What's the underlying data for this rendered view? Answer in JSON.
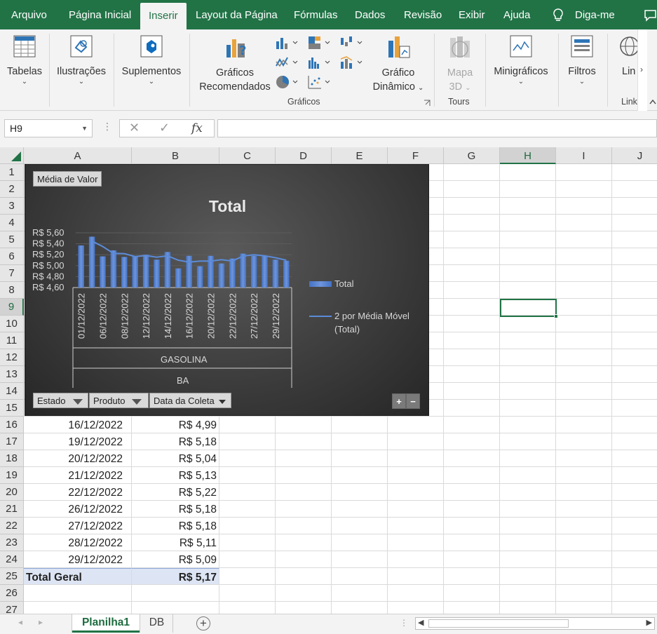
{
  "menu": {
    "tabs": [
      {
        "label": "Arquivo"
      },
      {
        "label": "Página Inicial"
      },
      {
        "label": "Inserir"
      },
      {
        "label": "Layout da Página"
      },
      {
        "label": "Fórmulas"
      },
      {
        "label": "Dados"
      },
      {
        "label": "Revisão"
      },
      {
        "label": "Exibir"
      },
      {
        "label": "Ajuda"
      }
    ],
    "tell_me": "Diga-me",
    "active_tab": "Inserir"
  },
  "ribbon": {
    "tabelas": "Tabelas",
    "ilustracoes": "Ilustrações",
    "suplementos": "Suplementos",
    "graficos_rec_line1": "Gráficos",
    "graficos_rec_line2": "Recomendados",
    "grafico_din_line1": "Gráfico",
    "grafico_din_line2": "Dinâmico",
    "mapa_line1": "Mapa",
    "mapa_line2": "3D",
    "minigraficos": "Minigráficos",
    "filtros": "Filtros",
    "links": "Lin",
    "group_graficos": "Gráficos",
    "group_tours": "Tours",
    "group_links": "Link"
  },
  "formula_bar": {
    "name_box": "H9",
    "fx": "fx",
    "formula": ""
  },
  "columns": [
    "A",
    "B",
    "C",
    "D",
    "E",
    "F",
    "G",
    "H",
    "I",
    "J"
  ],
  "selected_column": "H",
  "selected_row": "9",
  "rows": [
    "1",
    "2",
    "3",
    "4",
    "5",
    "6",
    "7",
    "8",
    "9",
    "10",
    "11",
    "12",
    "13",
    "14",
    "15",
    "16",
    "17",
    "18",
    "19",
    "20",
    "21",
    "22",
    "23",
    "24",
    "25",
    "26",
    "27"
  ],
  "table_rows": [
    {
      "date": "16/12/2022",
      "value": "R$ 4,99"
    },
    {
      "date": "19/12/2022",
      "value": "R$ 5,18"
    },
    {
      "date": "20/12/2022",
      "value": "R$ 5,04"
    },
    {
      "date": "21/12/2022",
      "value": "R$ 5,13"
    },
    {
      "date": "22/12/2022",
      "value": "R$ 5,22"
    },
    {
      "date": "26/12/2022",
      "value": "R$ 5,18"
    },
    {
      "date": "27/12/2022",
      "value": "R$ 5,18"
    },
    {
      "date": "28/12/2022",
      "value": "R$ 5,11"
    },
    {
      "date": "29/12/2022",
      "value": "R$ 5,09"
    }
  ],
  "total_row": {
    "label": "Total Geral",
    "value": "R$ 5,17"
  },
  "chart": {
    "value_button": "Média de Valor",
    "filter_estado": "Estado",
    "filter_produto": "Produto",
    "filter_data": "Data da Coleta",
    "plus": "+",
    "minus": "−",
    "product_label": "GASOLINA",
    "state_label": "BA",
    "legend_total": "Total",
    "legend_ma_line1": "2 por Média Móvel",
    "legend_ma_line2": "(Total)",
    "colors": {
      "bar": "#4472c4",
      "line": "#5b8bd9",
      "background": "#3d3d3d"
    }
  },
  "chart_data": {
    "type": "bar",
    "title": "Total",
    "y_tick_labels": [
      "R$ 5,60",
      "R$ 5,40",
      "R$ 5,20",
      "R$ 5,00",
      "R$ 4,80",
      "R$ 4,60"
    ],
    "ylim": [
      4.6,
      5.6
    ],
    "x_tick_labels": [
      "01/12/2022",
      "06/12/2022",
      "08/12/2022",
      "12/12/2022",
      "14/12/2022",
      "16/12/2022",
      "20/12/2022",
      "22/12/2022",
      "27/12/2022",
      "29/12/2022"
    ],
    "series": [
      {
        "name": "Total",
        "type": "bar",
        "values": [
          5.37,
          5.53,
          5.17,
          5.28,
          5.16,
          5.17,
          5.2,
          5.11,
          5.25,
          4.95,
          5.18,
          4.99,
          5.18,
          5.04,
          5.13,
          5.22,
          5.18,
          5.18,
          5.11,
          5.09
        ]
      },
      {
        "name": "2 por Média Móvel (Total)",
        "type": "line",
        "values": [
          null,
          5.45,
          5.35,
          5.225,
          5.22,
          5.165,
          5.185,
          5.155,
          5.18,
          5.1,
          5.065,
          5.085,
          5.085,
          5.11,
          5.085,
          5.175,
          5.2,
          5.18,
          5.145,
          5.1
        ]
      }
    ]
  },
  "sheets": {
    "tab1": "Planilha1",
    "tab2": "DB",
    "add": "+"
  }
}
